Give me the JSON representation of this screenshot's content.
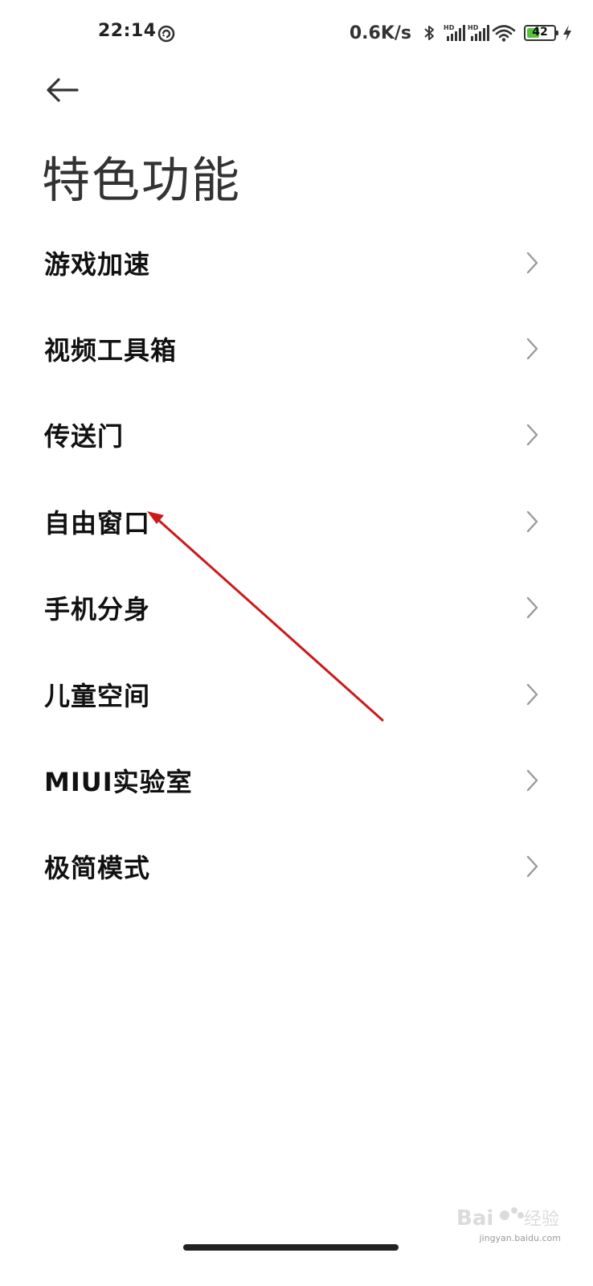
{
  "status_bar": {
    "time": "22:14",
    "net_speed": "0.6K/s",
    "battery_level": "42",
    "battery_percent": 42,
    "icons": [
      "sync-icon",
      "bluetooth-icon",
      "hd-signal-icon",
      "hd-signal-icon",
      "wifi-icon",
      "battery-icon",
      "charging-icon"
    ]
  },
  "header": {
    "back_icon": "back-arrow-icon",
    "title": "特色功能"
  },
  "menu": {
    "items": [
      {
        "label": "游戏加速"
      },
      {
        "label": "视频工具箱"
      },
      {
        "label": "传送门"
      },
      {
        "label": "自由窗口"
      },
      {
        "label": "手机分身"
      },
      {
        "label": "儿童空间"
      },
      {
        "label": "MIUI实验室"
      },
      {
        "label": "极简模式"
      }
    ]
  },
  "annotation": {
    "arrow_color": "#cc1a1a"
  },
  "watermark": {
    "text": "jingyan.baidu.com"
  },
  "colors": {
    "title_text": "#333333",
    "item_text": "#111111",
    "chevron": "#9a9a9a",
    "battery_fill": "#55c43a"
  }
}
